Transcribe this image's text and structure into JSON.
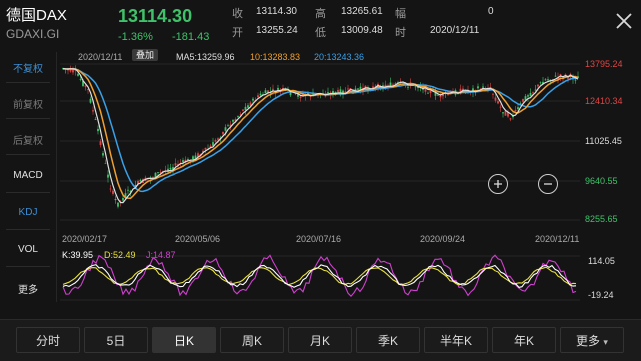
{
  "header": {
    "name": "德国DAX",
    "code": "GDAXI.GI",
    "price": "13114.30",
    "pct": "-1.36%",
    "change": "-181.43",
    "stats": [
      {
        "label": "收",
        "value": "13114.30"
      },
      {
        "label": "高",
        "value": "13265.61"
      },
      {
        "label": "幅",
        "value": "0"
      },
      {
        "label": "开",
        "value": "13255.24"
      },
      {
        "label": "低",
        "value": "13009.48"
      },
      {
        "label": "时",
        "value": "2020/12/11"
      }
    ]
  },
  "sidebar": {
    "items": [
      "不复权",
      "前复权",
      "后复权",
      "MACD",
      "KDJ",
      "VOL",
      "更多"
    ]
  },
  "chart": {
    "date": "2020/12/11",
    "overlay_button": "叠加",
    "ma": [
      {
        "text": "MA5:13259.96",
        "color": "#e0e0e0"
      },
      {
        "text": "10:13283.83",
        "color": "#f0a030"
      },
      {
        "text": "20:13243.36",
        "color": "#3aa0e8"
      }
    ],
    "price_axis": [
      "13795.24",
      "12410.34",
      "11025.45",
      "9640.55",
      "8255.65"
    ],
    "price_axis_colors": [
      "#e04545",
      "#e04545",
      "#dddddd",
      "#3fc26a",
      "#3fc26a"
    ],
    "dates": [
      "2020/02/17",
      "2020/05/06",
      "2020/07/16",
      "2020/09/24",
      "2020/12/11"
    ],
    "zoom_in": "+",
    "zoom_out": "−"
  },
  "kdj": {
    "k": "K:39.95",
    "d": "D:52.49",
    "j": "J:14.87",
    "axis": [
      "114.05",
      "-19.24"
    ]
  },
  "tabs": [
    "分时",
    "5日",
    "日K",
    "周K",
    "月K",
    "季K",
    "半年K",
    "年K",
    "更多"
  ],
  "active_tab": 2,
  "colors": {
    "up": "#e04545",
    "down": "#3fc26a",
    "ma5": "#e0e0e0",
    "ma10": "#f0a030",
    "ma20": "#3aa0e8",
    "j": "#d040d0",
    "k_line": "#ffffff",
    "d_line": "#e8e040"
  }
}
